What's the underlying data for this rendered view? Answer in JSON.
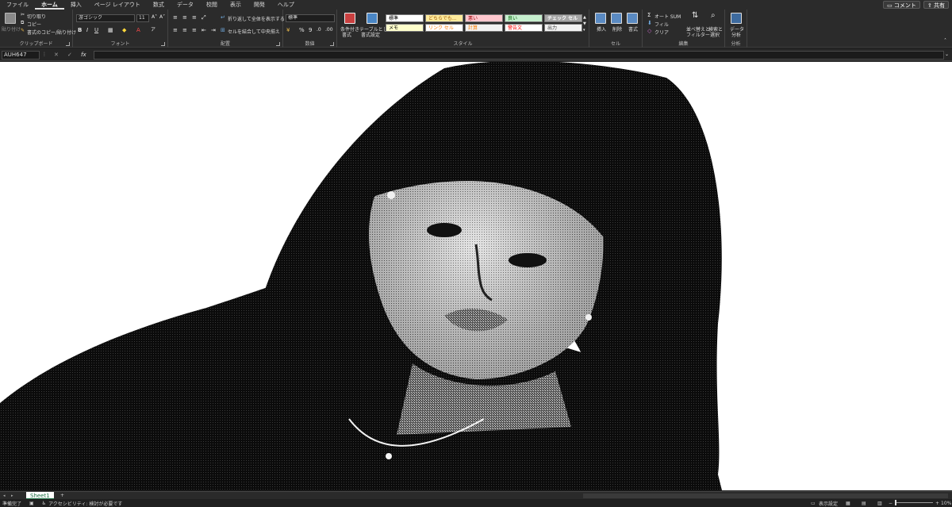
{
  "menu": {
    "tabs": [
      "ファイル",
      "ホーム",
      "挿入",
      "ページ レイアウト",
      "数式",
      "データ",
      "校閲",
      "表示",
      "開発",
      "ヘルプ"
    ],
    "active_index": 1,
    "comment_label": "コメント",
    "share_label": "共有"
  },
  "ribbon": {
    "clipboard": {
      "label": "クリップボード",
      "paste": "貼り付け",
      "cut": "切り取り",
      "copy": "コピー",
      "format_painter": "書式のコピー/貼り付け"
    },
    "font": {
      "label": "フォント",
      "font_name": "游ゴシック",
      "font_size": "11",
      "bold": "B",
      "italic": "I",
      "underline": "U",
      "grow": "A˄",
      "shrink": "A˅"
    },
    "alignment": {
      "label": "配置",
      "wrap_text": "折り返して全体を表示する",
      "merge_center": "セルを結合して中央揃え"
    },
    "number": {
      "label": "数値",
      "format": "標準",
      "percent": "%",
      "comma": "9"
    },
    "styles": {
      "label": "スタイル",
      "conditional": [
        "条件付き",
        "書式"
      ],
      "table": [
        "テーブルとして",
        "書式設定"
      ],
      "cells": [
        {
          "text": "標準",
          "bg": "#ffffff",
          "fg": "#000000"
        },
        {
          "text": "どちらでも...",
          "bg": "#ffeb9c",
          "fg": "#9c5700"
        },
        {
          "text": "悪い",
          "bg": "#ffc7ce",
          "fg": "#9c0006"
        },
        {
          "text": "良い",
          "bg": "#c6efce",
          "fg": "#006100"
        },
        {
          "text": "チェック セル",
          "bg": "#a5a5a5",
          "fg": "#ffffff"
        },
        {
          "text": "メモ",
          "bg": "#ffffcc",
          "fg": "#000000"
        },
        {
          "text": "リンク セル",
          "bg": "#ffffff",
          "fg": "#fa7d00"
        },
        {
          "text": "計算",
          "bg": "#f2f2f2",
          "fg": "#fa7d00"
        },
        {
          "text": "警告文",
          "bg": "#ffffff",
          "fg": "#ff0000"
        },
        {
          "text": "出力",
          "bg": "#f2f2f2",
          "fg": "#3f3f3f"
        }
      ]
    },
    "cells": {
      "label": "セル",
      "insert": "挿入",
      "delete": "削除",
      "format": "書式"
    },
    "editing": {
      "label": "編集",
      "autosum": "オート SUM",
      "fill": "フィル",
      "clear": "クリア",
      "sort_filter": [
        "並べ替えと",
        "フィルター"
      ],
      "find_select": [
        "検索と",
        "選択"
      ]
    },
    "analysis": {
      "label": "分析",
      "data_analysis": [
        "データ",
        "分析"
      ]
    }
  },
  "formula_bar": {
    "name_box": "AUH647",
    "fx": "fx",
    "cancel": "✕",
    "enter": "✓"
  },
  "sheet_tabs": {
    "active": "Sheet1",
    "add": "+"
  },
  "status": {
    "ready": "準備完了",
    "accessibility": "アクセシビリティ: 検討が必要です",
    "display_settings": "表示設定",
    "zoom": "10%"
  },
  "colors": {
    "ribbon_bg": "#2b2b2b",
    "sheet_bg": "#ffffff",
    "accent_green": "#1e7145"
  }
}
